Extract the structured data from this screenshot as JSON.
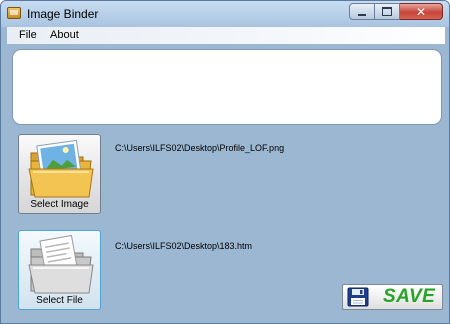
{
  "window": {
    "title": "Image Binder"
  },
  "titlebar_buttons": [
    "minimize",
    "maximize",
    "close"
  ],
  "menu": {
    "items": [
      "File",
      "About"
    ]
  },
  "image_picker": {
    "label": "Select Image",
    "icon": "image-folder-icon",
    "path": "C:\\Users\\ILFS02\\Desktop\\Profile_LOF.png"
  },
  "file_picker": {
    "label": "Select File",
    "icon": "file-folder-icon",
    "path": "C:\\Users\\ILFS02\\Desktop\\183.htm"
  },
  "save": {
    "label": "SAVE",
    "icon": "floppy-disk-icon",
    "color": "#27a327"
  }
}
